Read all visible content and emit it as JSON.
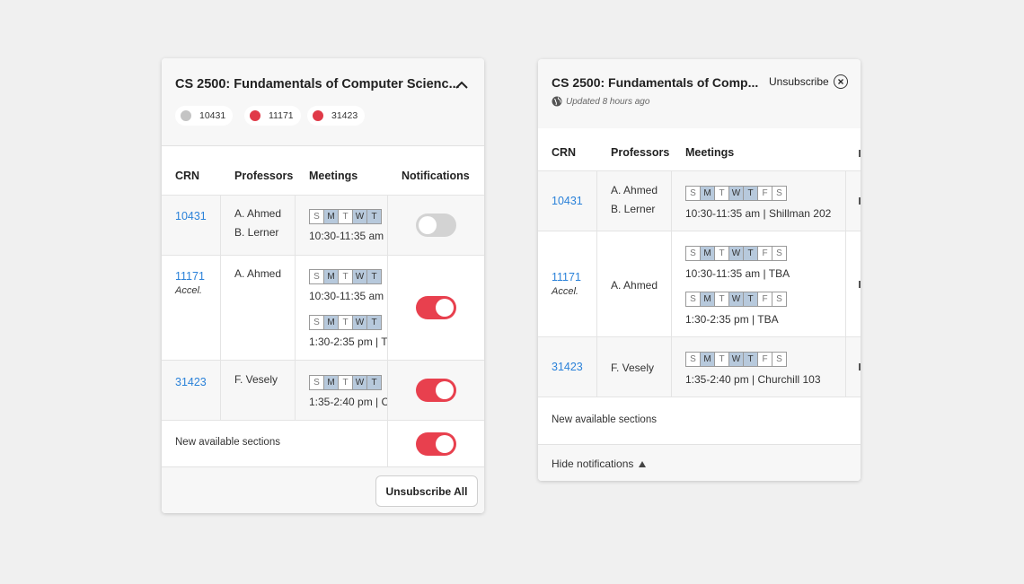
{
  "card1": {
    "title": "CS 2500: Fundamentals of Computer Scienc...",
    "chips": [
      {
        "label": "10431",
        "color": "#c4c4c4"
      },
      {
        "label": "11171",
        "color": "#e03a48"
      },
      {
        "label": "31423",
        "color": "#e03a48"
      }
    ],
    "headers": {
      "crn": "CRN",
      "professors": "Professors",
      "meetings": "Meetings",
      "notifications": "Notifications"
    },
    "rows": [
      {
        "crn": "10431",
        "accel": "",
        "prof1": "A. Ahmed",
        "prof2": "B. Lerner",
        "meetings": [
          {
            "days": [
              "S",
              "M",
              "T",
              "W",
              "T"
            ],
            "time": "10:30-11:35 am"
          }
        ],
        "notify": false
      },
      {
        "crn": "11171",
        "accel": "Accel.",
        "prof1": "A. Ahmed",
        "prof2": "",
        "meetings": [
          {
            "days": [
              "S",
              "M",
              "T",
              "W",
              "T"
            ],
            "time": "10:30-11:35 am"
          },
          {
            "days": [
              "S",
              "M",
              "T",
              "W",
              "T"
            ],
            "time": "1:30-2:35 pm | T"
          }
        ],
        "notify": true
      },
      {
        "crn": "31423",
        "accel": "",
        "prof1": "F. Vesely",
        "prof2": "",
        "meetings": [
          {
            "days": [
              "S",
              "M",
              "T",
              "W",
              "T"
            ],
            "time": "1:35-2:40 pm | C"
          }
        ],
        "notify": true
      }
    ],
    "new_sections_label": "New available sections",
    "new_sections_notify": true,
    "unsubscribe_all": "Unsubscribe All"
  },
  "card2": {
    "title": "CS 2500: Fundamentals of Comp...",
    "updated": "Updated 8 hours ago",
    "unsubscribe": "Unsubscribe",
    "headers": {
      "crn": "CRN",
      "professors": "Professors",
      "meetings": "Meetings"
    },
    "rows": [
      {
        "crn": "10431",
        "accel": "",
        "prof1": "A. Ahmed",
        "prof2": "B. Lerner",
        "meetings": [
          {
            "days": [
              "S",
              "M",
              "T",
              "W",
              "T",
              "F",
              "S"
            ],
            "time": "10:30-11:35 am | Shillman 202"
          }
        ]
      },
      {
        "crn": "11171",
        "accel": "Accel.",
        "prof1": "A. Ahmed",
        "prof2": "",
        "meetings": [
          {
            "days": [
              "S",
              "M",
              "T",
              "W",
              "T",
              "F",
              "S"
            ],
            "time": "10:30-11:35 am | TBA"
          },
          {
            "days": [
              "S",
              "M",
              "T",
              "W",
              "T",
              "F",
              "S"
            ],
            "time": "1:30-2:35 pm | TBA"
          }
        ]
      },
      {
        "crn": "31423",
        "accel": "",
        "prof1": "F. Vesely",
        "prof2": "",
        "meetings": [
          {
            "days": [
              "S",
              "M",
              "T",
              "W",
              "T",
              "F",
              "S"
            ],
            "time": "1:35-2:40 pm | Churchill 103"
          }
        ]
      }
    ],
    "new_sections_label": "New available sections",
    "hide_notifications": "Hide notifications"
  },
  "active_days": [
    false,
    true,
    false,
    true,
    true,
    false,
    false
  ],
  "icons": {
    "collapse": "chevron-up-icon",
    "close": "close-circle-icon",
    "globe": "globe-icon",
    "hide": "triangle-up-icon"
  }
}
